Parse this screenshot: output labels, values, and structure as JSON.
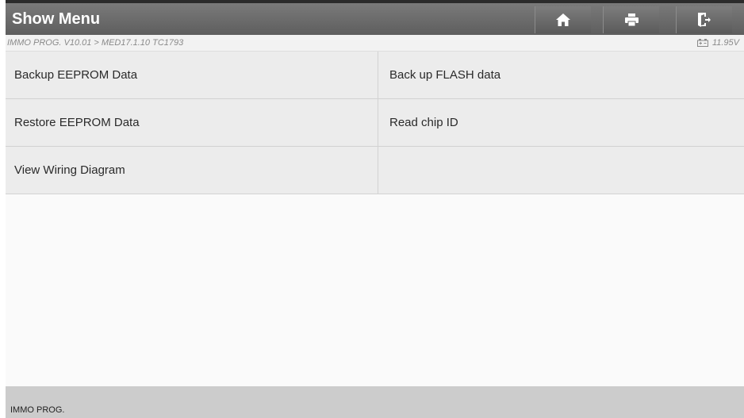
{
  "header": {
    "title": "Show Menu",
    "buttons": [
      {
        "icon": "home-icon"
      },
      {
        "icon": "printer-icon"
      },
      {
        "icon": "exit-icon"
      }
    ]
  },
  "breadcrumb": {
    "path": "IMMO PROG. V10.01 > MED17.1.10 TC1793",
    "battery_icon": "battery-icon",
    "voltage": "11.95V"
  },
  "menu": {
    "items": [
      "Backup EEPROM Data",
      "Back up FLASH data",
      "Restore EEPROM Data",
      "Read chip ID",
      "View Wiring Diagram",
      ""
    ]
  },
  "footer": {
    "label": "IMMO PROG."
  }
}
